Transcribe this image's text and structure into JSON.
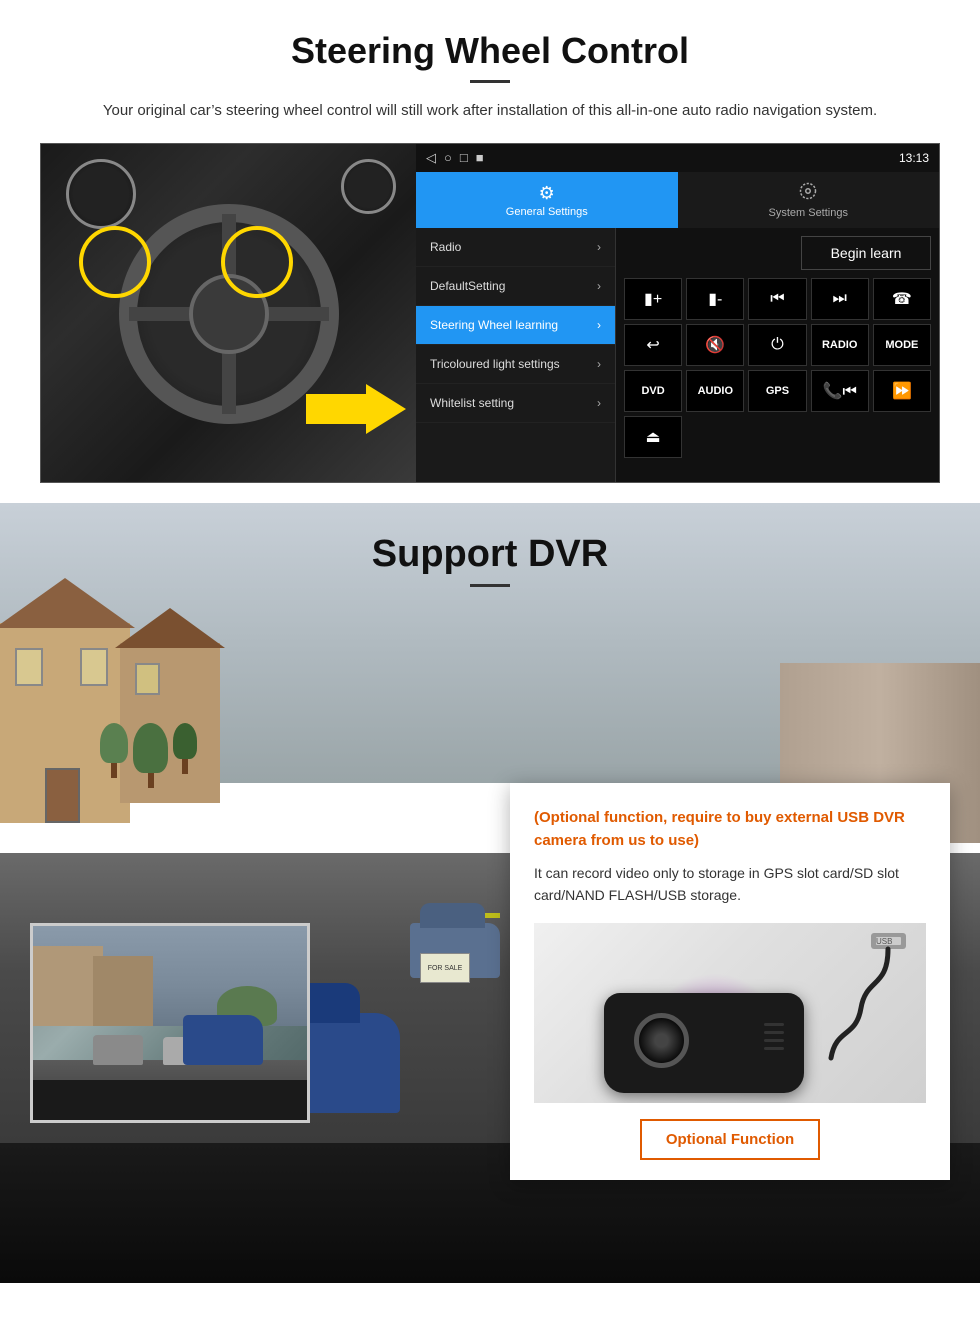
{
  "page": {
    "title": "Steering Wheel Control",
    "subtitle": "Your original car’s steering wheel control will still work after installation of this all-in-one auto radio navigation system.",
    "title_divider": true
  },
  "android_ui": {
    "statusbar": {
      "time": "13:13",
      "icons": [
        "◁",
        "○",
        "□",
        "■"
      ]
    },
    "tabs": [
      {
        "label": "General Settings",
        "icon": "⚙",
        "active": true
      },
      {
        "label": "System Settings",
        "icon": "🔧",
        "active": false
      }
    ],
    "menu_items": [
      {
        "label": "Radio",
        "active": false
      },
      {
        "label": "DefaultSetting",
        "active": false
      },
      {
        "label": "Steering Wheel learning",
        "active": true
      },
      {
        "label": "Tricoloured light settings",
        "active": false
      },
      {
        "label": "Whitelist setting",
        "active": false
      }
    ],
    "begin_learn_label": "Begin learn",
    "control_buttons": [
      {
        "label": "⏮+",
        "type": "icon"
      },
      {
        "label": "⏮-",
        "type": "icon"
      },
      {
        "label": "⏮",
        "type": "icon"
      },
      {
        "label": "⏭",
        "type": "icon"
      },
      {
        "label": "📞",
        "type": "icon"
      },
      {
        "label": "↩",
        "type": "icon"
      },
      {
        "label": "🔇",
        "type": "icon"
      },
      {
        "label": "⏻",
        "type": "icon"
      },
      {
        "label": "RADIO",
        "type": "text"
      },
      {
        "label": "MODE",
        "type": "text"
      },
      {
        "label": "DVD",
        "type": "text"
      },
      {
        "label": "AUDIO",
        "type": "text"
      },
      {
        "label": "GPS",
        "type": "text"
      },
      {
        "label": "📞⏮",
        "type": "icon"
      },
      {
        "label": "⏩",
        "type": "icon"
      },
      {
        "label": "⏏",
        "type": "icon"
      }
    ]
  },
  "dvr_section": {
    "title": "Support DVR",
    "optional_text": "(Optional function, require to buy external USB DVR camera from us to use)",
    "description": "It can record video only to storage in GPS slot card/SD slot card/NAND FLASH/USB storage.",
    "optional_button_label": "Optional Function",
    "for_sale_text": "FOR SALE"
  },
  "colors": {
    "accent_blue": "#2196F3",
    "accent_orange": "#e05a00",
    "dark_bg": "#000",
    "panel_bg": "#1a1a1a",
    "active_tab": "#2196F3"
  }
}
